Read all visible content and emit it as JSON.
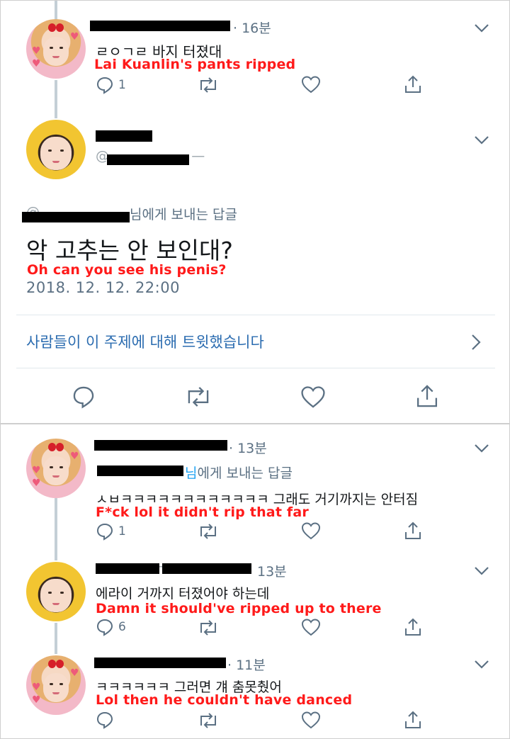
{
  "colors": {
    "accent": "#1da1f2",
    "secondary_text": "#5b7083",
    "translation": "#ff1a1a",
    "redaction": "#000000"
  },
  "tweet1": {
    "time": "· 16분",
    "text": "ㄹㅇㄱㄹ 바지 터졌대",
    "translation": "Lai Kuanlin's pants ripped",
    "reply_count": "1",
    "icons": [
      "reply-icon",
      "retweet-icon",
      "like-icon",
      "share-icon"
    ]
  },
  "main_tweet": {
    "reply_prefix": "님에게 보내는 답글",
    "text": "악 고추는 안 보인대?",
    "translation": "Oh can you see his penis?",
    "date": "2018. 12. 12. 22:00",
    "topic_link": "사람들이 이 주제에 대해 트윗했습니다"
  },
  "reply1": {
    "time": "· 13분",
    "reply_mention": "님",
    "reply_suffix": "에게 보내는 답글",
    "text": "ㅅㅂㅋㅋㅋㅋㅋㅋㅋㅋㅋㅋㅋㅋ 그래도 거기까지는 안터짐",
    "translation": "F*ck lol it didn't rip that far",
    "reply_count": "1"
  },
  "reply2": {
    "time": "13분",
    "text": "에라이 거까지 터졌어야 하는데",
    "translation": "Damn it should've ripped up to there",
    "reply_count": "6"
  },
  "reply3": {
    "time": "· 11분",
    "text": "ㅋㅋㅋㅋㅋㅋ 그러면 걔 춤못췄어",
    "translation": "Lol then he couldn't have danced"
  }
}
